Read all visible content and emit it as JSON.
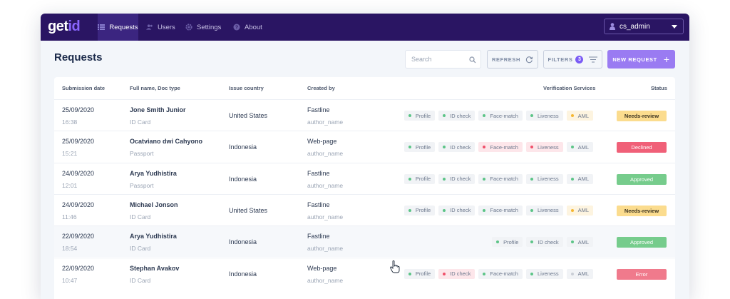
{
  "nav": {
    "logo_part1": "get",
    "logo_part2": "id",
    "items": [
      {
        "label": "Requests",
        "icon": "list-icon",
        "active": true
      },
      {
        "label": "Users",
        "icon": "users-icon",
        "active": false
      },
      {
        "label": "Settings",
        "icon": "gear-icon",
        "active": false
      },
      {
        "label": "About",
        "icon": "question-icon",
        "active": false
      }
    ],
    "user": {
      "label": "cs_admin",
      "icon": "user-icon"
    }
  },
  "header": {
    "title": "Requests",
    "search_placeholder": "Search",
    "refresh_label": "REFRESH",
    "filters_label": "FILTERS",
    "filters_count": "3",
    "new_request_label": "NEW REQUEST"
  },
  "table": {
    "columns": {
      "date": "Submission date",
      "name": "Full name, Doc type",
      "country": "Issue country",
      "created": "Created by",
      "services": "Verification Services",
      "status": "Status"
    },
    "rows": [
      {
        "date": "25/09/2020",
        "time": "16:38",
        "name": "Jone  Smith Junior",
        "doc": "ID Card",
        "country": "United States",
        "created_by": "Fastline",
        "author": "author_name",
        "services": [
          {
            "label": "Profile",
            "state": "ok"
          },
          {
            "label": "ID check",
            "state": "ok"
          },
          {
            "label": "Face-match",
            "state": "ok"
          },
          {
            "label": "Liveness",
            "state": "ok"
          },
          {
            "label": "AML",
            "state": "warn"
          }
        ],
        "status": "Needs-review",
        "status_kind": "review"
      },
      {
        "date": "25/09/2020",
        "time": "15:21",
        "name": "Ocatviano dwi  Cahyono",
        "doc": "Passport",
        "country": "Indonesia",
        "created_by": "Web-page",
        "author": "author_name",
        "services": [
          {
            "label": "Profile",
            "state": "ok"
          },
          {
            "label": "ID check",
            "state": "ok"
          },
          {
            "label": "Face-match",
            "state": "err"
          },
          {
            "label": "Liveness",
            "state": "err"
          },
          {
            "label": "AML",
            "state": "ok"
          }
        ],
        "status": "Declined",
        "status_kind": "declined"
      },
      {
        "date": "24/09/2020",
        "time": "12:01",
        "name": "Arya  Yudhistira",
        "doc": "Passport",
        "country": "Indonesia",
        "created_by": "Fastline",
        "author": "author_name",
        "services": [
          {
            "label": "Profile",
            "state": "ok"
          },
          {
            "label": "ID check",
            "state": "ok"
          },
          {
            "label": "Face-match",
            "state": "ok"
          },
          {
            "label": "Liveness",
            "state": "ok"
          },
          {
            "label": "AML",
            "state": "ok"
          }
        ],
        "status": "Approved",
        "status_kind": "approved"
      },
      {
        "date": "24/09/2020",
        "time": "11:46",
        "name": "Michael  Jonson",
        "doc": "ID Card",
        "country": "United States",
        "created_by": "Fastline",
        "author": "author_name",
        "services": [
          {
            "label": "Profile",
            "state": "ok"
          },
          {
            "label": "ID check",
            "state": "ok"
          },
          {
            "label": "Face-match",
            "state": "ok"
          },
          {
            "label": "Liveness",
            "state": "ok"
          },
          {
            "label": "AML",
            "state": "warn"
          }
        ],
        "status": "Needs-review",
        "status_kind": "review"
      },
      {
        "date": "22/09/2020",
        "time": "18:54",
        "name": "Arya  Yudhistira",
        "doc": "ID Card",
        "country": "Indonesia",
        "created_by": "Fastline",
        "author": "author_name",
        "services": [
          {
            "label": "Profile",
            "state": "ok"
          },
          {
            "label": "ID check",
            "state": "ok"
          },
          {
            "label": "AML",
            "state": "ok"
          }
        ],
        "status": "Approved",
        "status_kind": "approved"
      },
      {
        "date": "22/09/2020",
        "time": "10:47",
        "name": "Stephan  Avakov",
        "doc": "ID Card",
        "country": "Indonesia",
        "created_by": "Web-page",
        "author": "author_name",
        "services": [
          {
            "label": "Profile",
            "state": "ok"
          },
          {
            "label": "ID check",
            "state": "err"
          },
          {
            "label": "Face-match",
            "state": "ok"
          },
          {
            "label": "Liveness",
            "state": "ok"
          },
          {
            "label": "AML",
            "state": "none"
          }
        ],
        "status": "Error",
        "status_kind": "error"
      }
    ]
  },
  "colors": {
    "nav_bg": "#2a1563",
    "accent": "#8a66ff",
    "ok": "#5cc487",
    "err": "#f0506a",
    "warn": "#f5b731",
    "none": "#c9ced6"
  }
}
